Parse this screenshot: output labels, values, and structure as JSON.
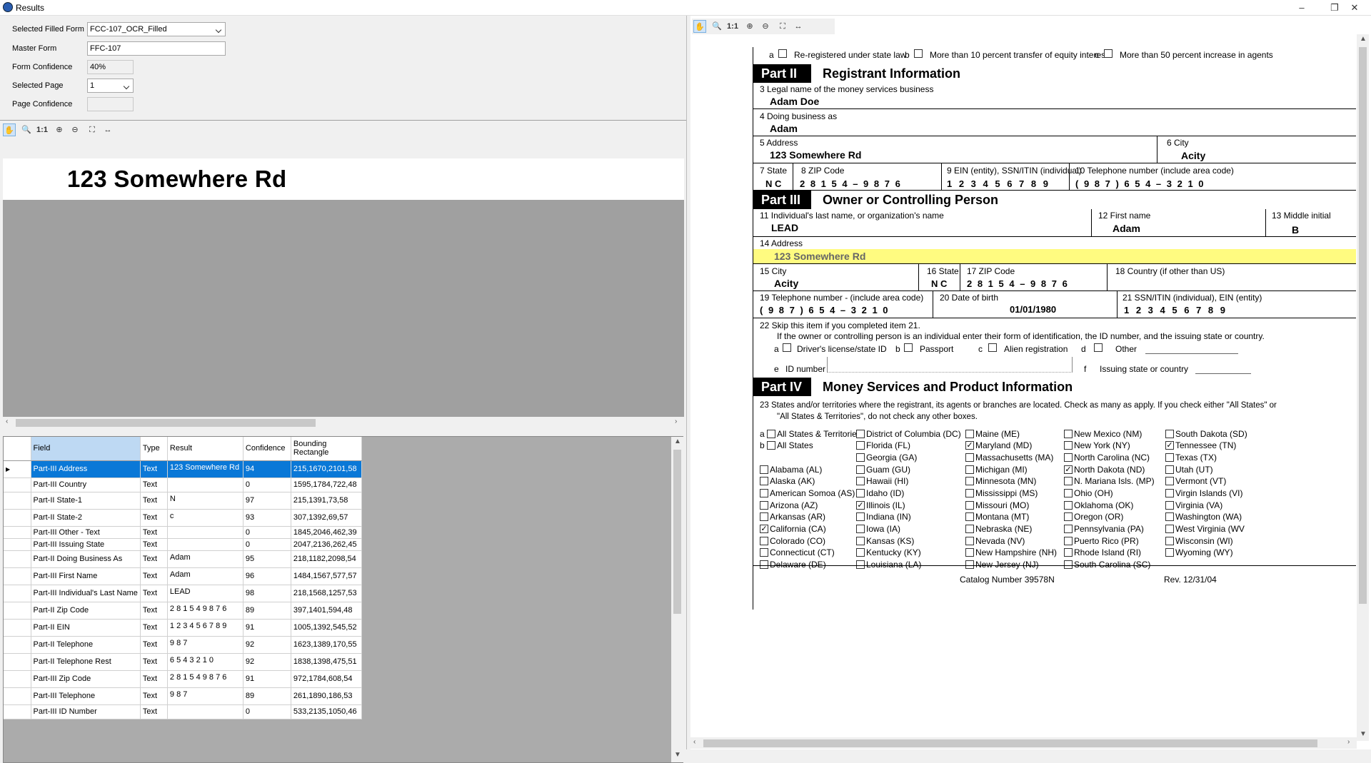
{
  "window": {
    "title": "Results",
    "minimize": "–",
    "maximize": "❐",
    "close": "✕"
  },
  "settings": {
    "selected_filled_form_label": "Selected Filled Form",
    "selected_filled_form_value": "FCC-107_OCR_Filled",
    "master_form_label": "Master Form",
    "master_form_value": "FFC-107",
    "form_confidence_label": "Form Confidence",
    "form_confidence_value": "40%",
    "selected_page_label": "Selected Page",
    "selected_page_value": "1",
    "page_confidence_label": "Page Confidence",
    "page_confidence_value": ""
  },
  "toolbar": {
    "pan_icon": "hand-icon",
    "zoom_icon": "zoom-icon",
    "one_to_one": "1:1",
    "zoom_in": "zoom-in-icon",
    "zoom_out": "zoom-out-icon",
    "fit": "fit-icon",
    "fit_width": "fit-width-icon"
  },
  "snippet": {
    "text": "123 Somewhere Rd"
  },
  "grid": {
    "headers": [
      "Field",
      "Type",
      "Result",
      "Confidence",
      "Bounding Rectangle"
    ],
    "rows": [
      {
        "field": "Part-III Address",
        "type": "Text",
        "result": "123 Somewhere Rd",
        "confidence": "94",
        "rect": "215,1670,2101,58"
      },
      {
        "field": "Part-III Country",
        "type": "Text",
        "result": "",
        "confidence": "0",
        "rect": "1595,1784,722,48"
      },
      {
        "field": "Part-II State-1",
        "type": "Text",
        "result": "N",
        "confidence": "97",
        "rect": "215,1391,73,58"
      },
      {
        "field": "Part-II State-2",
        "type": "Text",
        "result": "c",
        "confidence": "93",
        "rect": "307,1392,69,57"
      },
      {
        "field": "Part-III Other - Text",
        "type": "Text",
        "result": "",
        "confidence": "0",
        "rect": "1845,2046,462,39"
      },
      {
        "field": "Part-III Issuing State",
        "type": "Text",
        "result": "",
        "confidence": "0",
        "rect": "2047,2136,262,45"
      },
      {
        "field": "Part-II Doing Business As",
        "type": "Text",
        "result": "Adam",
        "confidence": "95",
        "rect": "218,1182,2098,54"
      },
      {
        "field": "Part-III First Name",
        "type": "Text",
        "result": "Adam",
        "confidence": "96",
        "rect": "1484,1567,577,57"
      },
      {
        "field": "Part-III Individual's Last Name",
        "type": "Text",
        "result": "LEAD",
        "confidence": "98",
        "rect": "218,1568,1257,53"
      },
      {
        "field": "Part-II Zip Code",
        "type": "Text",
        "result": "2 8 1 5 4 9 8 7 6",
        "confidence": "89",
        "rect": "397,1401,594,48"
      },
      {
        "field": "Part-II EIN",
        "type": "Text",
        "result": "1 2 3 4 5 6 7 8 9",
        "confidence": "91",
        "rect": "1005,1392,545,52"
      },
      {
        "field": "Part-II Telephone",
        "type": "Text",
        "result": "9 8 7",
        "confidence": "92",
        "rect": "1623,1389,170,55"
      },
      {
        "field": "Part-II Telephone Rest",
        "type": "Text",
        "result": "6 5 4 3 2 1 0",
        "confidence": "92",
        "rect": "1838,1398,475,51"
      },
      {
        "field": "Part-III Zip Code",
        "type": "Text",
        "result": "2 8 1 5 4 9 8 7 6",
        "confidence": "91",
        "rect": "972,1784,608,54"
      },
      {
        "field": "Part-III Telephone",
        "type": "Text",
        "result": "9 8 7",
        "confidence": "89",
        "rect": "261,1890,186,53"
      },
      {
        "field": "Part-III ID Number",
        "type": "Text",
        "result": "",
        "confidence": "0",
        "rect": "533,2135,1050,46"
      }
    ]
  },
  "form": {
    "top_a": "a",
    "top_a_text": "Re-registered under state law",
    "top_b": "b",
    "top_b_text": "More than 10 percent transfer of equity interest",
    "top_c": "c",
    "top_c_text": "More than 50 percent increase in agents",
    "part2_num": "Part II",
    "part2_title": "Registrant Information",
    "f3_label": "3  Legal name of the money services business",
    "f3_value": "Adam Doe",
    "f4_label": "4  Doing business as",
    "f4_value": "Adam",
    "f5_label": "5  Address",
    "f5_value": "123 Somewhere Rd",
    "f6_label": "6  City",
    "f6_value": "Acity",
    "f7_label": "7  State",
    "f7_value": "N  C",
    "f8_label": "8  ZIP Code",
    "f8_value": "2 8 1 5 4 – 9 8 7 6",
    "f9_label": "9  EIN (entity), SSN/ITIN (individual)",
    "f9_value": "1 2 3 4 5 6 7 8 9",
    "f10_label": "10  Telephone number (include area code)",
    "f10_value": "( 9 8 7 ) 6 5 4 – 3 2 1 0",
    "part3_num": "Part III",
    "part3_title": "Owner or Controlling Person",
    "f11_label": "11  Individual's last name, or organization's name",
    "f11_value": "LEAD",
    "f12_label": "12  First name",
    "f12_value": "Adam",
    "f13_label": "13  Middle initial",
    "f13_value": "B",
    "f14_label": "14  Address",
    "f14_value": "123 Somewhere Rd",
    "f15_label": "15  City",
    "f15_value": "Acity",
    "f16_label": "16  State",
    "f16_value": "N  C",
    "f17_label": "17  ZIP Code",
    "f17_value": "2 8 1 5 4 – 9 8 7 6",
    "f18_label": "18  Country (if other than US)",
    "f19_label": "19  Telephone number - (include area code)",
    "f19_value": "( 9 8 7 ) 6 5 4 – 3 2 1 0",
    "f20_label": "20  Date of birth",
    "f20_value": "01/01/1980",
    "f21_label": "21 SSN/ITIN (individual), EIN (entity)",
    "f21_value": "1 2 3 4 5 6 7 8 9",
    "f22_line1": "22  Skip this item if you completed item 21.",
    "f22_line2": "If the owner or controlling person is an individual enter their form of identification, the ID number, and the issuing state or country.",
    "f22_a": "a",
    "f22_a_text": "Driver's license/state ID",
    "f22_b": "b",
    "f22_b_text": "Passport",
    "f22_c": "c",
    "f22_c_text": "Alien registration",
    "f22_d": "d",
    "f22_d_text": "Other",
    "f22_e": "e",
    "f22_e_text": "ID number",
    "f22_f": "f",
    "f22_f_text": "Issuing state or country",
    "part4_num": "Part IV",
    "part4_title": "Money Services and Product Information",
    "f23_line1": "23   States and/or territories where the registrant, its agents or branches are located.  Check as many as apply.  If you check either \"All States\" or",
    "f23_line2": "\"All States & Territories\", do not check any other boxes.",
    "catalog": "Catalog Number 39578N",
    "rev": "Rev. 12/31/04",
    "states": [
      [
        {
          "pre": "a",
          "label": "All States & Territories",
          "checked": false
        },
        {
          "pre": "b",
          "label": "All States",
          "checked": false
        },
        {
          "pre": "",
          "label": "",
          "checked": false,
          "spacer": true
        },
        {
          "pre": "",
          "label": "Alabama  (AL)",
          "checked": false
        },
        {
          "pre": "",
          "label": "Alaska  (AK)",
          "checked": false
        },
        {
          "pre": "",
          "label": "American Somoa  (AS)",
          "checked": false
        },
        {
          "pre": "",
          "label": "Arizona  (AZ)",
          "checked": false
        },
        {
          "pre": "",
          "label": "Arkansas  (AR)",
          "checked": false
        },
        {
          "pre": "",
          "label": "California  (CA)",
          "checked": true
        },
        {
          "pre": "",
          "label": "Colorado  (CO)",
          "checked": false
        },
        {
          "pre": "",
          "label": "Connecticut  (CT)",
          "checked": false
        },
        {
          "pre": "",
          "label": "Delaware  (DE)",
          "checked": false
        }
      ],
      [
        {
          "label": "District of Columbia (DC)",
          "checked": false
        },
        {
          "label": "Florida  (FL)",
          "checked": false
        },
        {
          "label": "Georgia  (GA)",
          "checked": false
        },
        {
          "label": "Guam  (GU)",
          "checked": false
        },
        {
          "label": "Hawaii  (HI)",
          "checked": false
        },
        {
          "label": "Idaho  (ID)",
          "checked": false
        },
        {
          "label": "Illinois  (IL)",
          "checked": true
        },
        {
          "label": "Indiana  (IN)",
          "checked": false
        },
        {
          "label": "Iowa  (IA)",
          "checked": false
        },
        {
          "label": "Kansas  (KS)",
          "checked": false
        },
        {
          "label": "Kentucky  (KY)",
          "checked": false
        },
        {
          "label": "Louisiana  (LA)",
          "checked": false
        }
      ],
      [
        {
          "label": "Maine  (ME)",
          "checked": false
        },
        {
          "label": "Maryland  (MD)",
          "checked": true
        },
        {
          "label": "Massachusetts  (MA)",
          "checked": false
        },
        {
          "label": "Michigan  (MI)",
          "checked": false
        },
        {
          "label": "Minnesota  (MN)",
          "checked": false
        },
        {
          "label": "Mississippi  (MS)",
          "checked": false
        },
        {
          "label": "Missouri  (MO)",
          "checked": false
        },
        {
          "label": "Montana  (MT)",
          "checked": false
        },
        {
          "label": "Nebraska  (NE)",
          "checked": false
        },
        {
          "label": "Nevada  (NV)",
          "checked": false
        },
        {
          "label": "New Hampshire  (NH)",
          "checked": false
        },
        {
          "label": "New Jersey  (NJ)",
          "checked": false
        }
      ],
      [
        {
          "label": "New Mexico  (NM)",
          "checked": false
        },
        {
          "label": "New York  (NY)",
          "checked": false
        },
        {
          "label": "North Carolina  (NC)",
          "checked": false
        },
        {
          "label": "North Dakota  (ND)",
          "checked": true
        },
        {
          "label": "N. Mariana Isls.  (MP)",
          "checked": false
        },
        {
          "label": "Ohio  (OH)",
          "checked": false
        },
        {
          "label": "Oklahoma  (OK)",
          "checked": false
        },
        {
          "label": "Oregon  (OR)",
          "checked": false
        },
        {
          "label": "Pennsylvania  (PA)",
          "checked": false
        },
        {
          "label": "Puerto Rico  (PR)",
          "checked": false
        },
        {
          "label": "Rhode Island  (RI)",
          "checked": false
        },
        {
          "label": "South Carolina  (SC)",
          "checked": false
        }
      ],
      [
        {
          "label": "South Dakota  (SD)",
          "checked": false
        },
        {
          "label": "Tennessee  (TN)",
          "checked": true
        },
        {
          "label": "Texas  (TX)",
          "checked": false
        },
        {
          "label": "Utah  (UT)",
          "checked": false
        },
        {
          "label": "Vermont  (VT)",
          "checked": false
        },
        {
          "label": "Virgin Islands  (VI)",
          "checked": false
        },
        {
          "label": "Virginia  (VA)",
          "checked": false
        },
        {
          "label": "Washington  (WA)",
          "checked": false
        },
        {
          "label": "West Virginia  (WV",
          "checked": false
        },
        {
          "label": "Wisconsin  (WI)",
          "checked": false
        },
        {
          "label": "Wyoming  (WY)",
          "checked": false
        }
      ]
    ]
  }
}
